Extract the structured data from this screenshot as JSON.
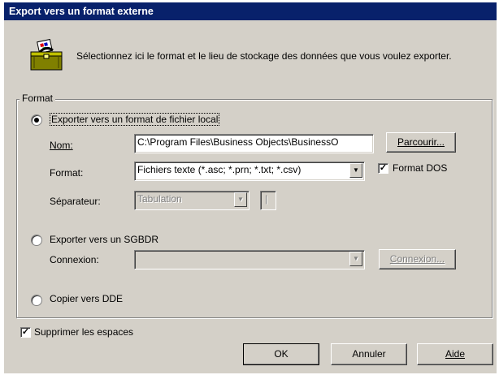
{
  "window": {
    "title": "Export vers un format externe"
  },
  "intro": {
    "text": "Sélectionnez ici le format et le lieu de stockage des données que vous voulez exporter."
  },
  "group": {
    "label": "Format"
  },
  "local": {
    "radio_label": "Exporter vers un format de fichier local",
    "nom_label": "Nom:",
    "nom_value": "C:\\Program Files\\Business Objects\\BusinessO",
    "browse_label": "Parcourir...",
    "format_label": "Format:",
    "format_value": "Fichiers texte (*.asc; *.prn; *.txt; *.csv)",
    "dos_label": "Format DOS",
    "separator_label": "Séparateur:",
    "separator_value": "Tabulation"
  },
  "sgbdr": {
    "radio_label": "Exporter vers un SGBDR",
    "connexion_label": "Connexion:",
    "connexion_button": "Connexion..."
  },
  "dde": {
    "radio_label": "Copier vers DDE"
  },
  "options": {
    "trim_label": "Supprimer les espaces"
  },
  "buttons": {
    "ok": "OK",
    "cancel": "Annuler",
    "help": "Aide"
  },
  "icons": {
    "dialog": "briefcase-export-icon",
    "dropdown": "chevron-down-icon",
    "check": "checkmark-icon"
  },
  "colors": {
    "titlebar": "#08216b",
    "face": "#d4d0c8"
  }
}
